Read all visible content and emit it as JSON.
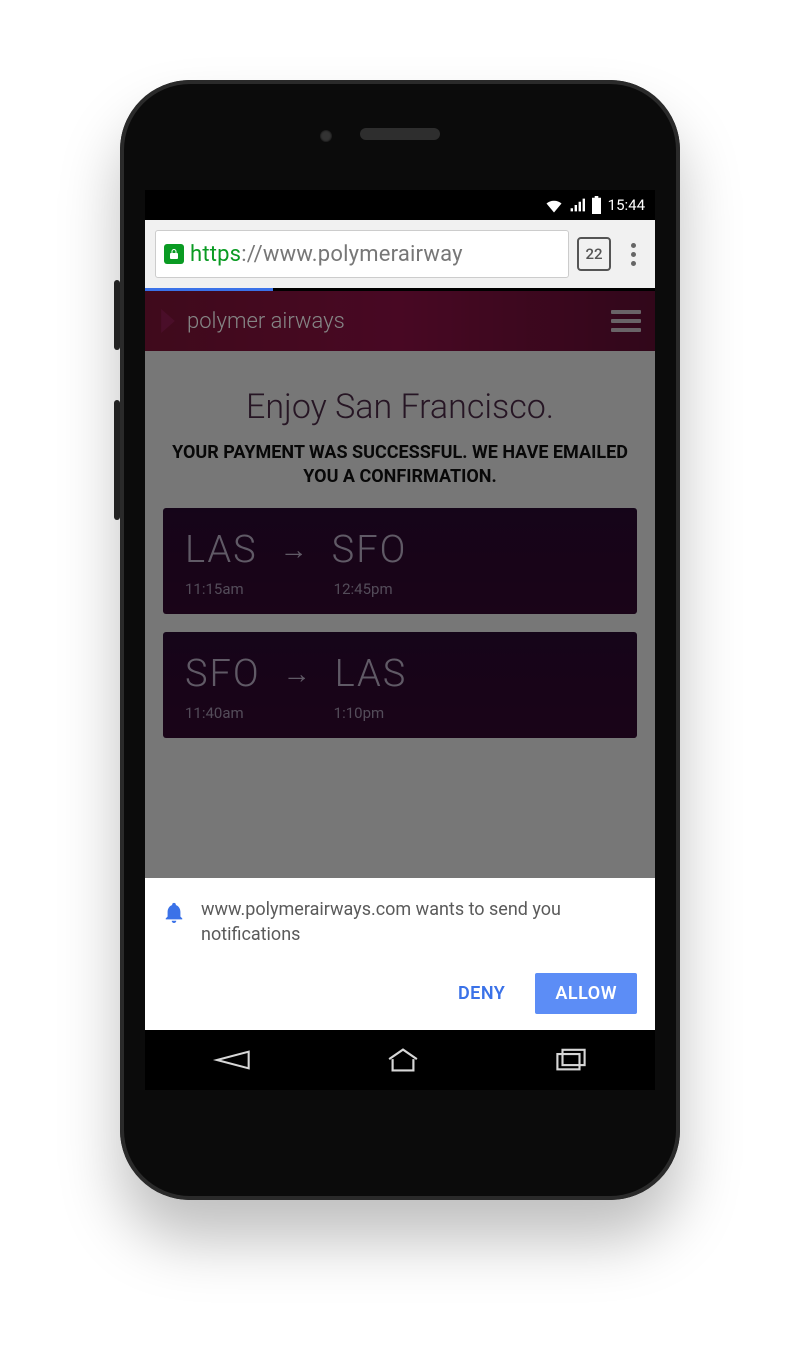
{
  "status_bar": {
    "time": "15:44"
  },
  "browser": {
    "url_protocol": "https",
    "url_sep": "://",
    "url_host_visible": "www.polymerairway",
    "tab_count": "22"
  },
  "app": {
    "brand": "polymer airways",
    "headline": "Enjoy San Francisco.",
    "confirmation": "YOUR PAYMENT WAS SUCCESSFUL. WE HAVE EMAILED YOU A CONFIRMATION.",
    "flights": [
      {
        "from": "LAS",
        "to": "SFO",
        "dep": "11:15am",
        "arr": "12:45pm"
      },
      {
        "from": "SFO",
        "to": "LAS",
        "dep": "11:40am",
        "arr": "1:10pm"
      }
    ]
  },
  "prompt": {
    "text": "www.polymerairways.com wants to send you notifications",
    "deny": "DENY",
    "allow": "ALLOW"
  }
}
